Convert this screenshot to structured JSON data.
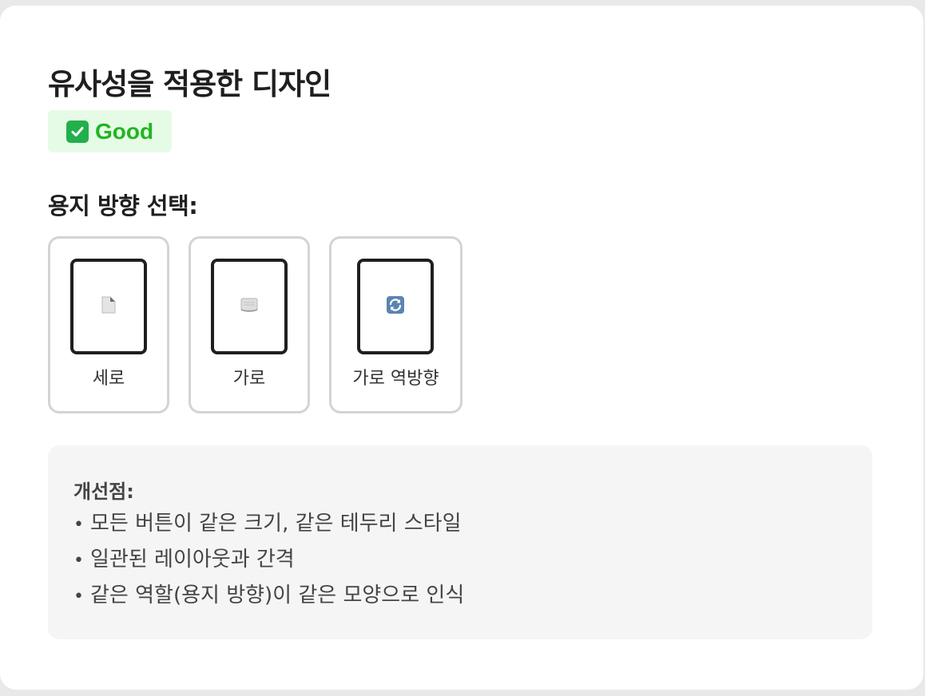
{
  "page": {
    "title": "유사성을 적용한 디자인",
    "badge": {
      "icon": "check-box-icon",
      "label": "Good",
      "color": "#22b522",
      "background": "#e6fbe6"
    },
    "section_label": "용지 방향 선택:"
  },
  "options": [
    {
      "label": "세로",
      "icon": "page-facing-up-icon"
    },
    {
      "label": "가로",
      "icon": "scroll-icon"
    },
    {
      "label": "가로 역방향",
      "icon": "refresh-arrows-icon"
    }
  ],
  "notes": {
    "title": "개선점:",
    "bullet": "•",
    "items": [
      "모든 버튼이 같은 크기, 같은 테두리 스타일",
      "일관된 레이아웃과 간격",
      "같은 역할(용지 방향)이 같은 모양으로 인식"
    ]
  }
}
